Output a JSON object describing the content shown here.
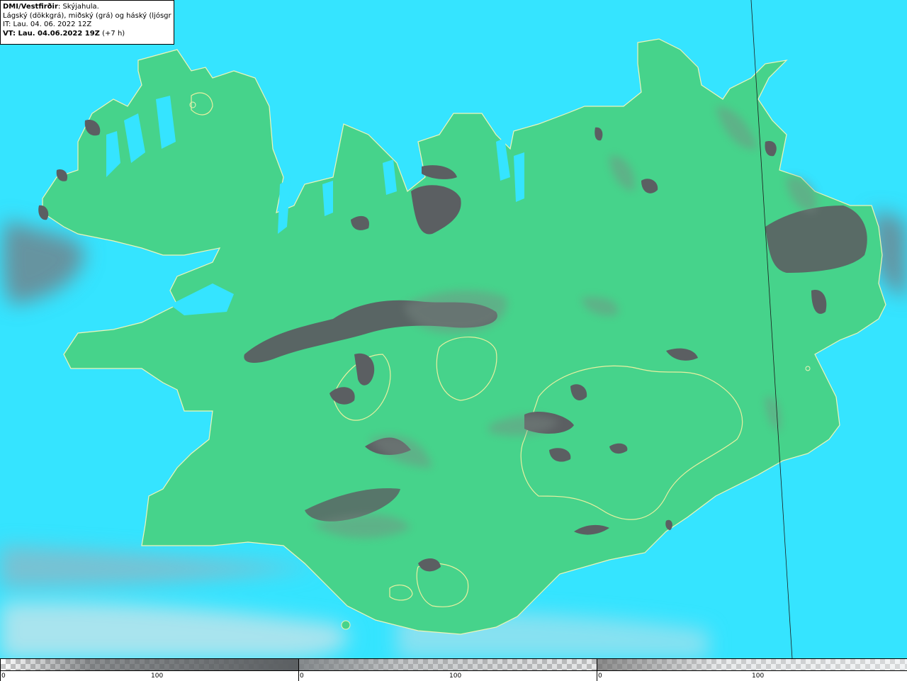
{
  "header": {
    "source": "DMI/Vestfirðir",
    "product": ": Skýjahula.",
    "description": "Lágský (dökkgrá), miðský (grá) og háský (ljósgrá)",
    "issue_time": "IT: Lau. 04. 06. 2022 12Z",
    "valid_time": "VT: Lau. 04.06.2022 19Z",
    "lead": "(+7 h)"
  },
  "colors": {
    "sea": "#35e4ff",
    "land": "#46d38b",
    "low_cloud": "#5b5f62",
    "mid_cloud": "#8a8f92",
    "high_cloud": "#cfd6d8",
    "glacier_outline": "#e8f0a0",
    "coastline": "#f0f4b8"
  },
  "legend": [
    {
      "name": "low",
      "min_label": "0",
      "max_label": "100",
      "color": "#5b5f62"
    },
    {
      "name": "mid",
      "min_label": "0",
      "max_label": "100",
      "color": "#8a8f92"
    },
    {
      "name": "high",
      "min_label": "0",
      "max_label": "100",
      "color": "#cfd6d8"
    }
  ]
}
